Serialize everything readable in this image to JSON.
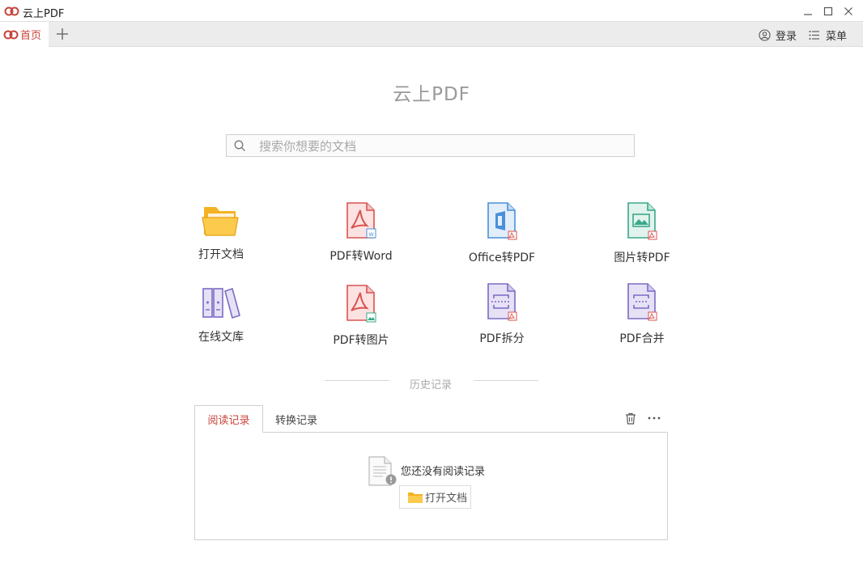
{
  "window": {
    "title": "云上PDF"
  },
  "tabs": {
    "home_label": "首页"
  },
  "top_actions": {
    "login_label": "登录",
    "menu_label": "菜单"
  },
  "main": {
    "app_title": "云上PDF"
  },
  "search": {
    "placeholder": "搜索你想要的文档",
    "value": ""
  },
  "tools": [
    {
      "label": "打开文档",
      "icon": "folder-open-icon"
    },
    {
      "label": "PDF转Word",
      "icon": "pdf-to-word-icon"
    },
    {
      "label": "Office转PDF",
      "icon": "office-to-pdf-icon"
    },
    {
      "label": "图片转PDF",
      "icon": "image-to-pdf-icon"
    },
    {
      "label": "在线文库",
      "icon": "online-library-icon"
    },
    {
      "label": "PDF转图片",
      "icon": "pdf-to-image-icon"
    },
    {
      "label": "PDF拆分",
      "icon": "pdf-split-icon"
    },
    {
      "label": "PDF合并",
      "icon": "pdf-merge-icon"
    }
  ],
  "history": {
    "title": "历史记录",
    "tabs": [
      "阅读记录",
      "转换记录"
    ],
    "empty_text": "您还没有阅读记录",
    "open_button_label": "打开文档"
  },
  "colors": {
    "accent": "#c8453c",
    "folder": "#f5b225",
    "pdf_red": "#d9534f",
    "office_blue": "#4a90d9",
    "image_teal": "#3aa88a",
    "split_purple": "#7b6bc4"
  }
}
